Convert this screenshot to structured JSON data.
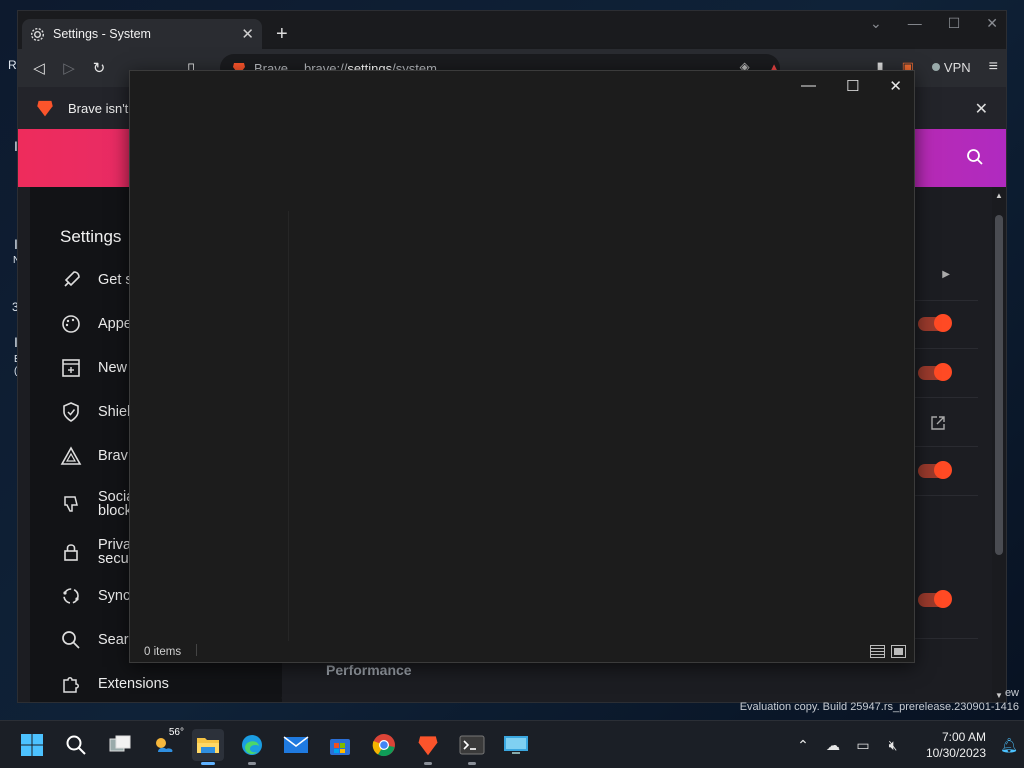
{
  "desktop": {
    "frag_r": "R",
    "frag_letters": [
      "I",
      "I",
      "N",
      "I",
      "E",
      "("
    ],
    "frag_3": "3",
    "watermark": "Evaluation copy. Build 25947.rs_prerelease.230901-1416",
    "frag_ew": "ew"
  },
  "browser": {
    "tab_title": "Settings - System",
    "tab_close": "✕",
    "new_tab": "+",
    "window_controls": [
      "⌄",
      "—",
      "☐",
      "✕"
    ],
    "omnibox_brand": "Brave",
    "omnibox_url_host": "brave://",
    "omnibox_url_bold": "settings",
    "omnibox_url_path": "/system",
    "vpn_label": "VPN",
    "infobar_message": "Brave isn't",
    "infobar_close": "✕"
  },
  "settings": {
    "title": "Settings",
    "nav": [
      {
        "label": "Get s",
        "icon": "rocket-icon"
      },
      {
        "label": "Appe",
        "icon": "palette-icon"
      },
      {
        "label": "New",
        "icon": "new-tab-icon"
      },
      {
        "label": "Shiel",
        "icon": "shield-icon"
      },
      {
        "label": "Brav",
        "icon": "brave-triangle-icon"
      },
      {
        "label": "Socia\nblock",
        "icon": "thumbs-down-icon"
      },
      {
        "label": "Priva\nsecu",
        "icon": "lock-icon"
      },
      {
        "label": "Sync",
        "icon": "sync-icon"
      },
      {
        "label": "Sear",
        "icon": "search-icon"
      },
      {
        "label": "Extensions",
        "icon": "puzzle-icon"
      }
    ],
    "performance_heading": "Performance"
  },
  "explorer": {
    "status_items": "0 items",
    "controls": [
      "—",
      "☐",
      "✕"
    ]
  },
  "taskbar": {
    "weather_temp": "56°",
    "clock_time": "7:00 AM",
    "clock_date": "10/30/2023",
    "apps": [
      "start-icon",
      "search-icon",
      "task-view-icon",
      "weather-icon",
      "file-explorer-icon",
      "edge-icon",
      "mail-icon",
      "store-icon",
      "chrome-icon",
      "brave-icon",
      "terminal-icon",
      "remote-desktop-icon"
    ]
  },
  "colors": {
    "banner_start": "#ee2c5c",
    "banner_end": "#b02ac0",
    "toggle_on": "#ff4a24",
    "accent": "#5fb2ff"
  }
}
